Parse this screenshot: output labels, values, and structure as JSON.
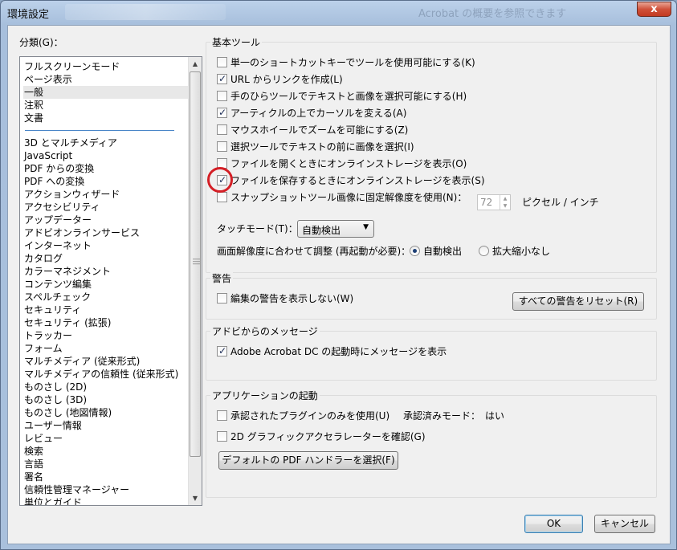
{
  "window": {
    "title": "環境設定",
    "ghost_title": "Acrobat の概要を参照できます",
    "close_label": "x"
  },
  "categories": {
    "label": "分類(G)：",
    "group1": [
      "フルスクリーンモード",
      "ページ表示",
      "一般",
      "注釈",
      "文書"
    ],
    "selected": "一般",
    "group2": [
      "3D とマルチメディア",
      "JavaScript",
      "PDF からの変換",
      "PDF への変換",
      "アクションウィザード",
      "アクセシビリティ",
      "アップデーター",
      "アドビオンラインサービス",
      "インターネット",
      "カタログ",
      "カラーマネジメント",
      "コンテンツ編集",
      "スペルチェック",
      "セキュリティ",
      "セキュリティ (拡張)",
      "トラッカー",
      "フォーム",
      "マルチメディア (従来形式)",
      "マルチメディアの信頼性 (従来形式)",
      "ものさし (2D)",
      "ものさし (3D)",
      "ものさし (地図情報)",
      "ユーザー情報",
      "レビュー",
      "検索",
      "言語",
      "署名",
      "信頼性管理マネージャー",
      "単位とガイド"
    ]
  },
  "basic_tools": {
    "title": "基本ツール",
    "options": [
      {
        "label": "単一のショートカットキーでツールを使用可能にする(K)",
        "checked": false
      },
      {
        "label": "URL からリンクを作成(L)",
        "checked": true
      },
      {
        "label": "手のひらツールでテキストと画像を選択可能にする(H)",
        "checked": false
      },
      {
        "label": "アーティクルの上でカーソルを変える(A)",
        "checked": true
      },
      {
        "label": "マウスホイールでズームを可能にする(Z)",
        "checked": false
      },
      {
        "label": "選択ツールでテキストの前に画像を選択(I)",
        "checked": false
      },
      {
        "label": "ファイルを開くときにオンラインストレージを表示(O)",
        "checked": false
      },
      {
        "label": "ファイルを保存するときにオンラインストレージを表示(S)",
        "checked": true
      },
      {
        "label": "スナップショットツール画像に固定解像度を使用(N)：",
        "checked": false
      }
    ],
    "snapshot_value": "72",
    "snapshot_unit": "ピクセル / インチ",
    "touch_mode_label": "タッチモード(T)：",
    "touch_mode_value": "自動検出",
    "resolution_label": "画面解像度に合わせて調整 (再起動が必要)：",
    "radio_auto": "自動検出",
    "radio_none": "拡大縮小なし"
  },
  "warnings": {
    "title": "警告",
    "option": "編集の警告を表示しない(W)",
    "reset_button": "すべての警告をリセット(R)"
  },
  "adobe_messages": {
    "title": "アドビからのメッセージ",
    "option": "Adobe Acrobat DC の起動時にメッセージを表示"
  },
  "app_startup": {
    "title": "アプリケーションの起動",
    "option_plugins": "承認されたプラグインのみを使用(U)",
    "certified_mode": "承認済みモード：　はい",
    "option_2d": "2D グラフィックアクセラレーターを確認(G)",
    "default_pdf_button": "デフォルトの PDF ハンドラーを選択(F)"
  },
  "footer": {
    "ok": "OK",
    "cancel": "キャンセル"
  },
  "colors": {
    "highlight_circle": "#d41f26",
    "selection_separator": "#4a86c8"
  }
}
